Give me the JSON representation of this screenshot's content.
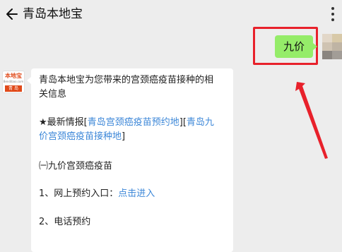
{
  "header": {
    "title": "青岛本地宝",
    "back_icon": "back-arrow-icon",
    "more_icon": "more-vertical-icon"
  },
  "sent_message": {
    "text": "九价"
  },
  "bot": {
    "avatar_name": "本地宝",
    "avatar_domain": "Bendibao.com",
    "avatar_city": "青 岛"
  },
  "received_message": {
    "intro_line1": "青岛本地宝为您带来的宫颈癌疫苗接种的相",
    "intro_line2": "关信息",
    "news_prefix": "★最新情报[",
    "news_link1": "青岛宫颈癌疫苗预约地",
    "news_mid": "][",
    "news_link2_part1": "青岛九",
    "news_link2_part2": "价宫颈癌疫苗接种地",
    "news_suffix": "]",
    "section1": "㈠九价宫颈癌疫苗",
    "item1_label": "1、网上预约入口：",
    "item1_link": "点击进入",
    "item2_label": "2、电话预约"
  },
  "colors": {
    "sent_bubble": "#95ec69",
    "link": "#3c87d8",
    "annotation": "#e8212b",
    "background": "#ededed"
  }
}
